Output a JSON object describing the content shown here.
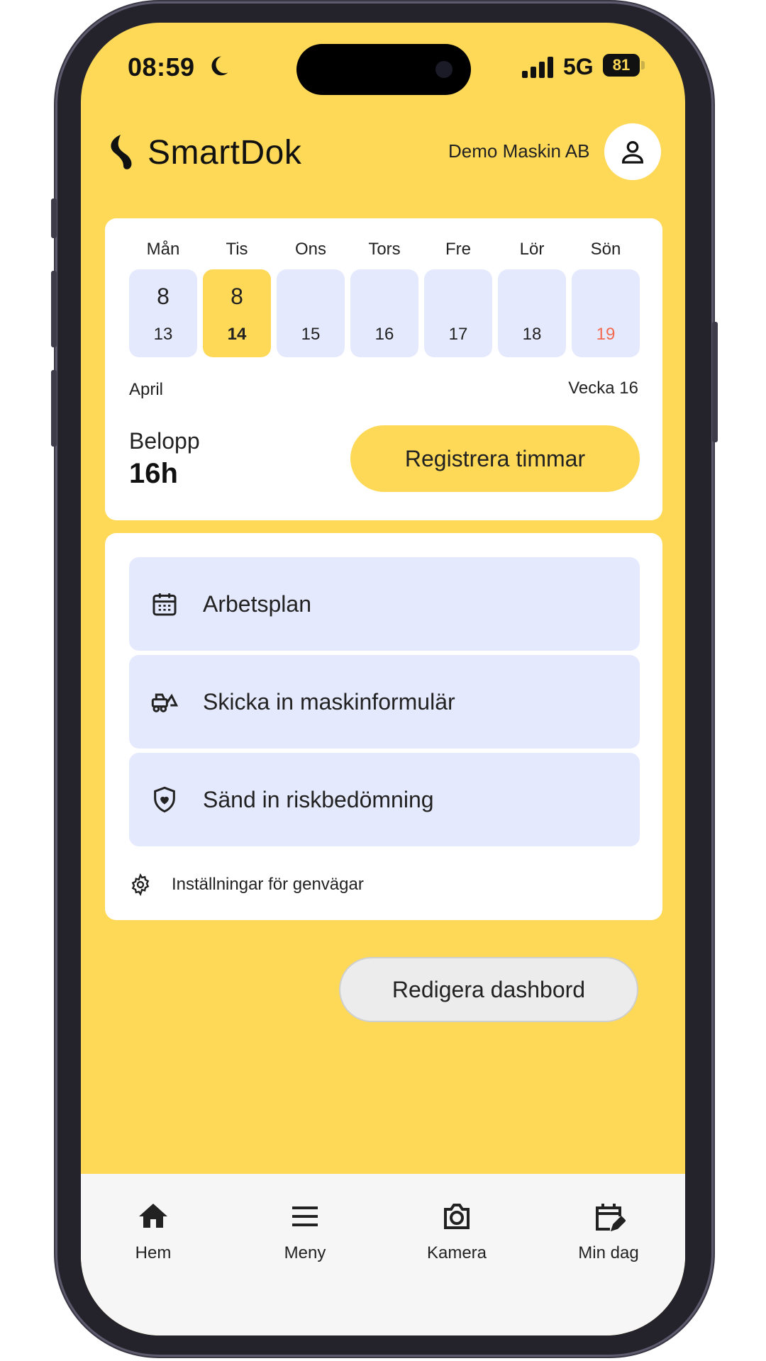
{
  "status_bar": {
    "time": "08:59",
    "network": "5G",
    "battery": "81"
  },
  "header": {
    "brand": "SmartDok",
    "company": "Demo Maskin AB"
  },
  "week": {
    "days": [
      {
        "name": "Mån",
        "hours": "8",
        "date": "13"
      },
      {
        "name": "Tis",
        "hours": "8",
        "date": "14"
      },
      {
        "name": "Ons",
        "hours": "",
        "date": "15"
      },
      {
        "name": "Tors",
        "hours": "",
        "date": "16"
      },
      {
        "name": "Fre",
        "hours": "",
        "date": "17"
      },
      {
        "name": "Lör",
        "hours": "",
        "date": "18"
      },
      {
        "name": "Sön",
        "hours": "",
        "date": "19"
      }
    ],
    "month": "April",
    "week_label": "Vecka 16",
    "amount_label": "Belopp",
    "amount_value": "16h",
    "register_label": "Registrera timmar"
  },
  "shortcuts": {
    "items": [
      {
        "label": "Arbetsplan",
        "icon": "calendar-icon"
      },
      {
        "label": "Skicka in maskinformulär",
        "icon": "machine-icon"
      },
      {
        "label": "Sänd in riskbedömning",
        "icon": "shield-heart-icon"
      }
    ],
    "settings_label": "Inställningar för genvägar"
  },
  "edit_dashboard_label": "Redigera dashbord",
  "bottom_nav": {
    "items": [
      {
        "label": "Hem",
        "icon": "home-icon"
      },
      {
        "label": "Meny",
        "icon": "menu-icon"
      },
      {
        "label": "Kamera",
        "icon": "camera-icon"
      },
      {
        "label": "Min dag",
        "icon": "calendar-edit-icon"
      }
    ]
  },
  "colors": {
    "background": "#fed957",
    "card": "#ffffff",
    "tile": "#e5e9fd",
    "accent": "#fed957",
    "sunday": "#f36a50",
    "nav_bg": "#f6f6f6"
  }
}
